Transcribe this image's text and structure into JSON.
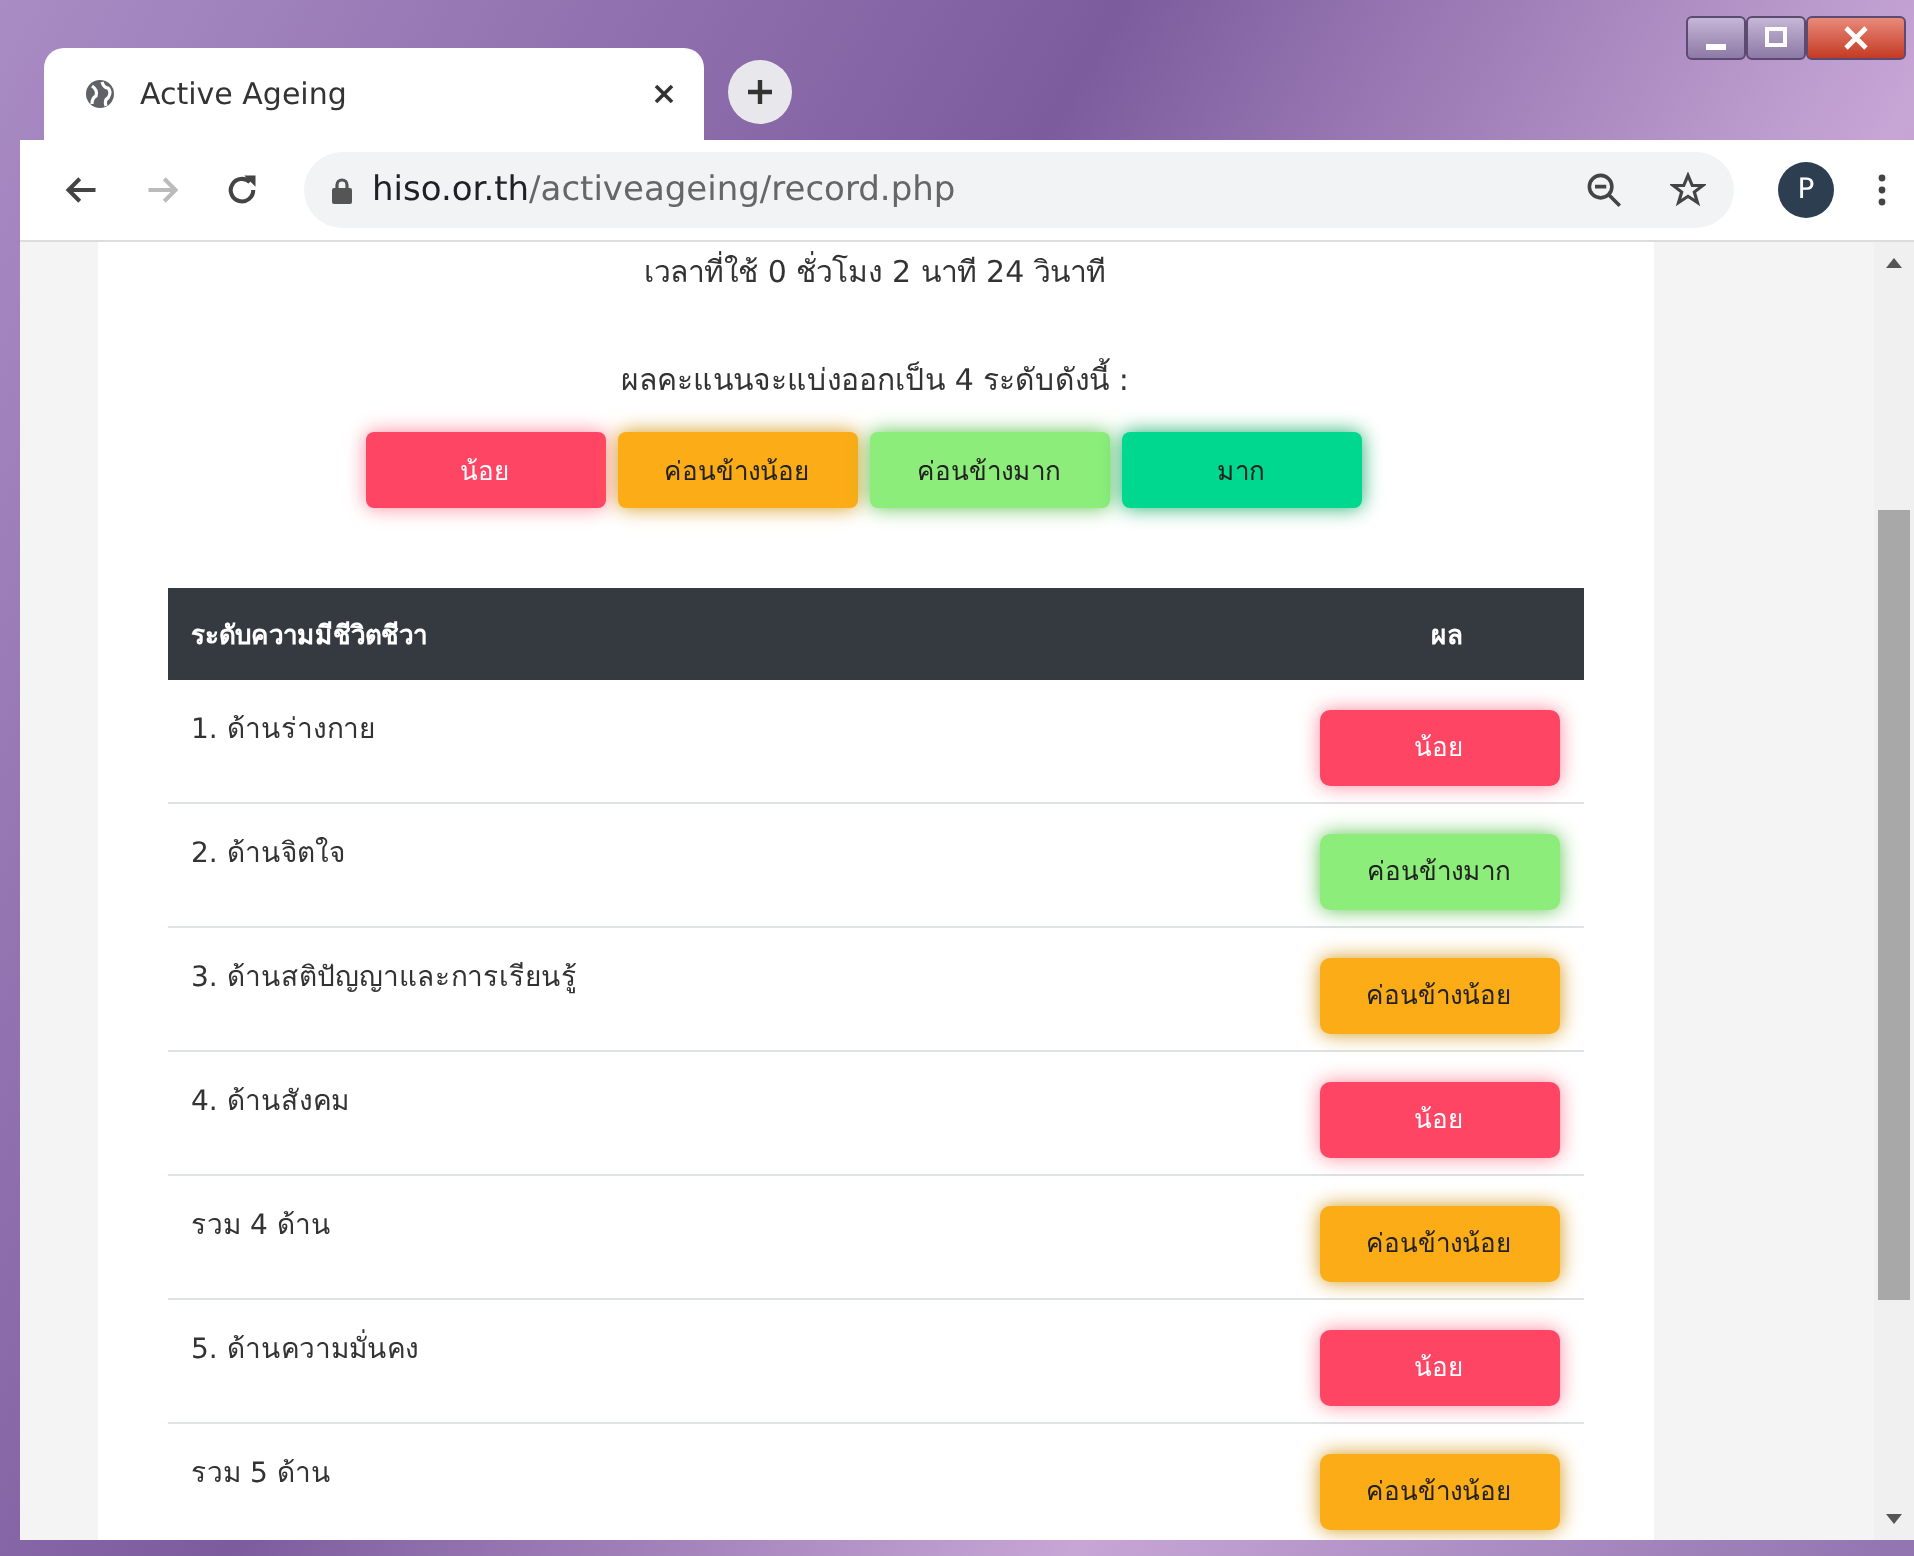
{
  "browser": {
    "tab_title": "Active Ageing",
    "url_host": "hiso.or.th",
    "url_path": "/activeageing/record.php",
    "profile_initial": "P"
  },
  "page": {
    "time_used": "เวลาที่ใช้ 0 ชั่วโมง 2 นาที 24 วินาที",
    "levels_intro": "ผลคะแนนจะแบ่งออกเป็น 4 ระดับดังนี้ :",
    "levels": [
      {
        "label": "น้อย",
        "kind": "low"
      },
      {
        "label": "ค่อนข้างน้อย",
        "kind": "fairly-low"
      },
      {
        "label": "ค่อนข้างมาก",
        "kind": "fairly-high"
      },
      {
        "label": "มาก",
        "kind": "high"
      }
    ],
    "table": {
      "columns": [
        "ระดับความมีชีวิตชีวา",
        "ผล"
      ],
      "rows": [
        {
          "aspect": "1. ด้านร่างกาย",
          "result": "น้อย",
          "kind": "low"
        },
        {
          "aspect": "2. ด้านจิตใจ",
          "result": "ค่อนข้างมาก",
          "kind": "fairly-high"
        },
        {
          "aspect": "3. ด้านสติปัญญาและการเรียนรู้",
          "result": "ค่อนข้างน้อย",
          "kind": "fairly-low"
        },
        {
          "aspect": "4. ด้านสังคม",
          "result": "น้อย",
          "kind": "low"
        },
        {
          "aspect": "รวม 4 ด้าน",
          "result": "ค่อนข้างน้อย",
          "kind": "fairly-low"
        },
        {
          "aspect": "5. ด้านความมั่นคง",
          "result": "น้อย",
          "kind": "low"
        },
        {
          "aspect": "รวม 5 ด้าน",
          "result": "ค่อนข้างน้อย",
          "kind": "fairly-low"
        }
      ]
    }
  }
}
